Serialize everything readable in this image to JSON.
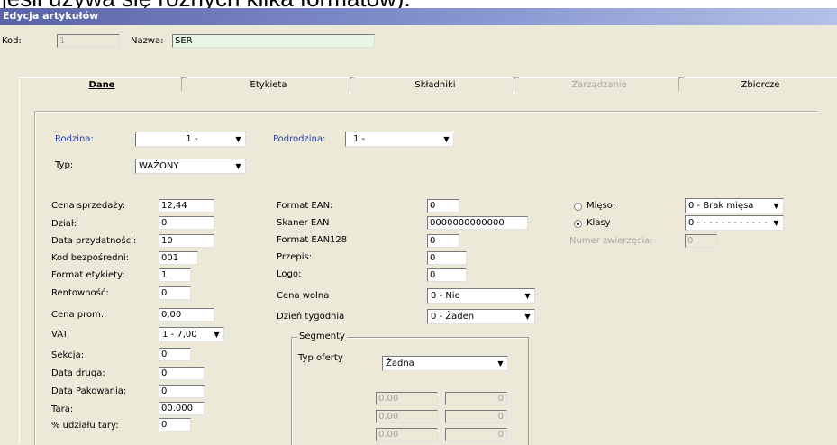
{
  "top_caption": "jeśli używa się różnych kilka formatów).",
  "window": {
    "title": "Edycja artykułów"
  },
  "header": {
    "kod_label": "Kod:",
    "kod_value": "1",
    "nazwa_label": "Nazwa:",
    "nazwa_value": "SER"
  },
  "tabs": [
    {
      "label": "Dane"
    },
    {
      "label": "Etykieta"
    },
    {
      "label": "Składniki"
    },
    {
      "label": "Zarządzanie"
    },
    {
      "label": "Zbiorcze"
    }
  ],
  "rodzina": {
    "label": "Rodzina:",
    "value": "1 -"
  },
  "podrodzina": {
    "label": "Podrodzina:",
    "value": "1 -"
  },
  "typ": {
    "label": "Typ:",
    "value": "WAŻONY"
  },
  "left_fields": {
    "cena_sprzedazy": {
      "label": "Cena sprzedaży:",
      "value": "12,44"
    },
    "dzial": {
      "label": "Dział:",
      "value": "0"
    },
    "data_przydatnosci": {
      "label": "Data przydatności:",
      "value": "10"
    },
    "kod_bezposredni": {
      "label": "Kod bezpośredni:",
      "value": "001"
    },
    "format_etykiety": {
      "label": "Format etykiety:",
      "value": "1"
    },
    "rentownosc": {
      "label": "Rentowność:",
      "value": "0"
    },
    "cena_prom": {
      "label": "Cena prom.:",
      "value": "0,00"
    },
    "vat": {
      "label": "VAT",
      "value": "1 - 7,00"
    },
    "sekcja": {
      "label": "Sekcja:",
      "value": "0"
    },
    "data_druga": {
      "label": "Data druga:",
      "value": "0"
    },
    "data_pakowania": {
      "label": "Data Pakowania:",
      "value": "0"
    },
    "tara": {
      "label": "Tara:",
      "value": "00.000"
    },
    "udzial_tary": {
      "label": "% udziału tary:",
      "value": "0"
    }
  },
  "mid_fields": {
    "format_ean": {
      "label": "Format EAN:",
      "value": "0"
    },
    "skaner_ean": {
      "label": "Skaner EAN",
      "value": "0000000000000"
    },
    "format_ean128": {
      "label": "Format EAN128",
      "value": "0"
    },
    "przepis": {
      "label": "Przepis:",
      "value": "0"
    },
    "logo": {
      "label": "Logo:",
      "value": "0"
    },
    "cena_wolna": {
      "label": "Cena wolna",
      "value": "0 - Nie"
    },
    "dzien_tygodnia": {
      "label": "Dzień tygodnia",
      "value": "0 - Żaden"
    }
  },
  "segmenty": {
    "legend": "Segmenty",
    "typ_oferty_label": "Typ oferty",
    "typ_oferty_value": "Żadna",
    "rows": [
      {
        "a": "0.00",
        "b": "0"
      },
      {
        "a": "0.00",
        "b": "0"
      },
      {
        "a": "0.00",
        "b": "0"
      }
    ]
  },
  "right_fields": {
    "mieso": {
      "label": "Mięso:",
      "value": "0 - Brak mięsa"
    },
    "klasy": {
      "label": "Klasy",
      "value": "0 - - - - - - - - - - - -"
    },
    "numer_zwierzecia": {
      "label": "Numer zwierzęcia:",
      "value": "0"
    }
  },
  "colors": {
    "title_gradient_start": "#5a63a8",
    "label_blue": "#2b3fa6",
    "field_green": "#e9f5e4",
    "window_bg": "#ece9d8"
  }
}
